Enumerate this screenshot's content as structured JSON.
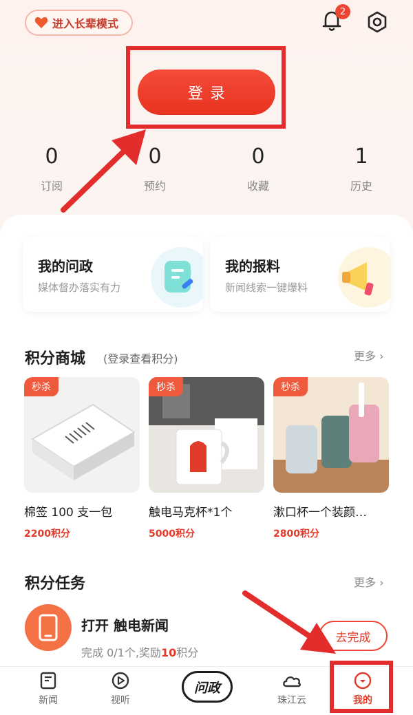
{
  "header": {
    "elder_mode_label": "进入长辈模式",
    "notification_count": "2",
    "login_label": "登录"
  },
  "stats": [
    {
      "value": "0",
      "label": "订阅"
    },
    {
      "value": "0",
      "label": "预约"
    },
    {
      "value": "0",
      "label": "收藏"
    },
    {
      "value": "1",
      "label": "历史"
    }
  ],
  "features": [
    {
      "title": "我的问政",
      "subtitle": "媒体督办落实有力",
      "icon": "note-pen-icon"
    },
    {
      "title": "我的报料",
      "subtitle": "新闻线索一键爆料",
      "icon": "megaphone-icon"
    }
  ],
  "points_mall": {
    "title": "积分商城",
    "note": "(登录查看积分)",
    "more_label": "更多",
    "flash_tag": "秒杀",
    "products": [
      {
        "name": "棉签 100 支一包",
        "price": "2200积分"
      },
      {
        "name": "触电马克杯*1个",
        "price": "5000积分"
      },
      {
        "name": "漱口杯一个装颜…",
        "price": "2800积分"
      }
    ]
  },
  "points_tasks": {
    "title": "积分任务",
    "more_label": "更多",
    "task": {
      "title": "打开 触电新闻",
      "desc_prefix": "完成 0/1个,奖励",
      "reward": "10",
      "desc_suffix": "积分",
      "button_label": "去完成"
    }
  },
  "tabbar": {
    "tabs": [
      {
        "label": "新闻",
        "icon": "news-icon"
      },
      {
        "label": "视听",
        "icon": "play-icon"
      },
      {
        "label": "问政",
        "icon": "wenzheng-logo"
      },
      {
        "label": "珠江云",
        "icon": "cloud-icon"
      },
      {
        "label": "我的",
        "icon": "profile-icon"
      }
    ]
  },
  "colors": {
    "accent": "#e8331f",
    "annotation": "#e32c2c"
  }
}
